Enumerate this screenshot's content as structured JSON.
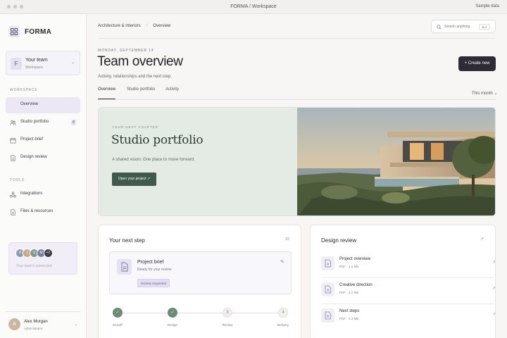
{
  "window": {
    "title": "FORMA / Workspace",
    "sample_label": "Sample data"
  },
  "brand": {
    "name": "FORMA"
  },
  "team": {
    "initial": "F",
    "name": "Your team",
    "sub": "Workspace"
  },
  "sidebar": {
    "workspace_label": "WORKSPACE",
    "tools_label": "TOOLS",
    "workspace_items": [
      {
        "label": "Overview"
      },
      {
        "label": "Studio portfolio",
        "badge": "8"
      },
      {
        "label": "Project brief"
      },
      {
        "label": "Design review"
      }
    ],
    "tool_items": [
      {
        "label": "Integrations"
      },
      {
        "label": "Files & resources"
      }
    ],
    "connected": {
      "avatars": [
        "A",
        "J",
        "S",
        "M"
      ],
      "more": "+2",
      "text": "Your team's connected"
    }
  },
  "user": {
    "initial": "A",
    "name": "Alex Morgan",
    "role": "Administrator"
  },
  "breadcrumb": {
    "parent": "Architecture & interiors",
    "sep": "/",
    "current": "Overview"
  },
  "search": {
    "placeholder": "Search anything",
    "shortcut": "⌘ K"
  },
  "header": {
    "date": "MONDAY, SEPTEMBER 14",
    "title": "Team overview",
    "subtitle": "Activity, relationships and the next step.",
    "create_label": "+ Create new"
  },
  "tabs": [
    {
      "label": "Overview"
    },
    {
      "label": "Studio portfolio"
    },
    {
      "label": "Activity"
    }
  ],
  "period": {
    "label": "This month ⌄"
  },
  "hero": {
    "kicker": "YOUR NEXT CHAPTER",
    "title": "Studio portfolio",
    "subtitle": "A shared vision. One place to move forward.",
    "button": "Open your project ↗"
  },
  "next_step": {
    "title": "Your next step",
    "count": "02",
    "item": {
      "title": "Project brief",
      "sub": "Ready for your review",
      "pill": "Review requested"
    },
    "steps": [
      {
        "label": "Kickoff",
        "mark": "✓",
        "done": true
      },
      {
        "label": "Design",
        "mark": "✓",
        "done": true
      },
      {
        "label": "Review",
        "mark": "3",
        "done": false
      },
      {
        "label": "Delivery",
        "mark": "4",
        "done": false
      }
    ]
  },
  "design_review": {
    "title": "Design review",
    "items": [
      {
        "name": "Project overview",
        "meta": "PDF · 1.2 MB"
      },
      {
        "name": "Creative direction",
        "meta": "PDF · 2.2 MB"
      },
      {
        "name": "Next steps",
        "meta": "PDF · 0.3 MB"
      }
    ]
  },
  "colors": {
    "accent": "#2c2b36",
    "hero_bg": "#e4ebe5",
    "hero_button": "#3f5a4b",
    "step_done": "#6c8a76",
    "nav_active": "#ebe7f5"
  }
}
